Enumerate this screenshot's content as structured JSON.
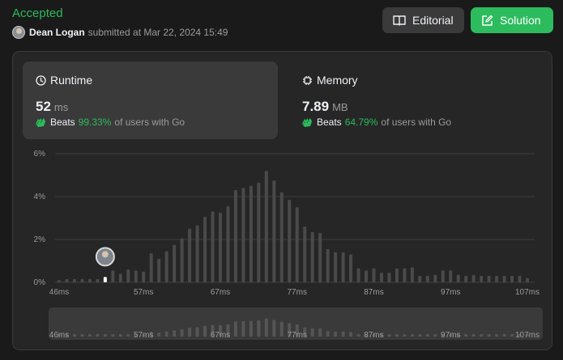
{
  "submission": {
    "status": "Accepted",
    "user": "Dean Logan",
    "submitted_text": "submitted at Mar 22, 2024 15:49"
  },
  "buttons": {
    "editorial": "Editorial",
    "solution": "Solution"
  },
  "runtime": {
    "title": "Runtime",
    "value": "52",
    "unit": "ms",
    "beats_label": "Beats",
    "beats_pct": "99.33%",
    "beats_suffix": "of users with Go"
  },
  "memory": {
    "title": "Memory",
    "value": "7.89",
    "unit": "MB",
    "beats_label": "Beats",
    "beats_pct": "64.79%",
    "beats_suffix": "of users with Go"
  },
  "colors": {
    "accent": "#2cbb5d",
    "bar": "#4a4a4a",
    "current_bar": "#ffffff"
  },
  "icons": {
    "editorial": "book-icon",
    "solution": "edit-icon",
    "runtime": "clock-icon",
    "memory": "chip-icon",
    "beats": "clap-hands-icon"
  },
  "chart_data": {
    "type": "bar",
    "ylabel": "",
    "xlabel": "",
    "y_ticks": [
      "6%",
      "4%",
      "2%",
      "0%"
    ],
    "ylim": [
      0,
      6
    ],
    "x_ticks": [
      "46ms",
      "57ms",
      "67ms",
      "77ms",
      "87ms",
      "97ms",
      "107ms"
    ],
    "x_tick_values": [
      46,
      57,
      67,
      77,
      87,
      97,
      107
    ],
    "x": [
      46,
      47,
      48,
      49,
      50,
      51,
      52,
      53,
      54,
      55,
      56,
      57,
      58,
      59,
      60,
      61,
      62,
      63,
      64,
      65,
      66,
      67,
      68,
      69,
      70,
      71,
      72,
      73,
      74,
      75,
      76,
      77,
      78,
      79,
      80,
      81,
      82,
      83,
      84,
      85,
      86,
      87,
      88,
      89,
      90,
      91,
      92,
      93,
      94,
      95,
      96,
      97,
      98,
      99,
      100,
      101,
      102,
      103,
      104,
      105,
      106,
      107
    ],
    "values": [
      0.1,
      0.15,
      0.15,
      0.15,
      0.15,
      0.15,
      0.25,
      0.55,
      0.4,
      0.6,
      0.55,
      0.5,
      1.35,
      1.1,
      1.45,
      1.75,
      2.05,
      2.5,
      2.65,
      3.05,
      3.3,
      3.25,
      3.55,
      4.3,
      4.4,
      4.5,
      4.65,
      5.2,
      4.75,
      4.2,
      3.85,
      3.5,
      2.6,
      2.35,
      2.3,
      1.55,
      1.4,
      1.4,
      1.3,
      0.65,
      0.55,
      0.65,
      0.45,
      0.45,
      0.65,
      0.65,
      0.7,
      0.3,
      0.3,
      0.35,
      0.55,
      0.55,
      0.35,
      0.3,
      0.35,
      0.3,
      0.3,
      0.3,
      0.3,
      0.3,
      0.3,
      0.2
    ],
    "current_x": 52,
    "overview_x_ticks": [
      "46ms",
      "57ms",
      "67ms",
      "77ms",
      "87ms",
      "97ms",
      "107ms"
    ]
  }
}
